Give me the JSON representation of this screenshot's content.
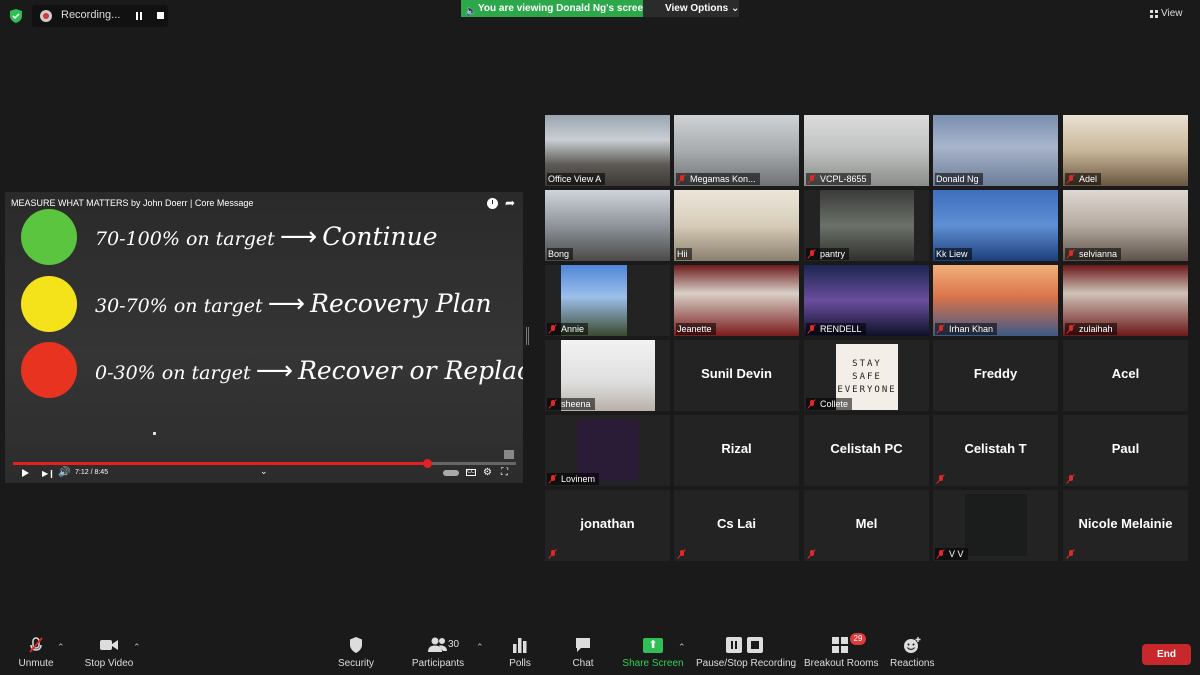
{
  "top": {
    "recording_label": "Recording...",
    "viewing_banner": "You are viewing Donald Ng's screen",
    "view_options": "View Options ⌄",
    "view_label": "View"
  },
  "share": {
    "video_title": "MEASURE WHAT MATTERS by John Doerr | Core Message",
    "lines": [
      {
        "pct": "70-100% on target",
        "action": "Continue"
      },
      {
        "pct": "30-70% on target",
        "action": "Recovery Plan"
      },
      {
        "pct": "0-30% on target",
        "action": "Recover or Replace"
      }
    ],
    "arrow": "⟶",
    "time": "7:12 / 8:45",
    "progress_fraction": 0.824
  },
  "tiles": [
    {
      "name": "Office View A",
      "type": "video",
      "muted": false,
      "bg": "linear-gradient(180deg,#9aa6b2 0%,#c9ced3 35%,#5d5a55 70%,#3d3a36 100%)"
    },
    {
      "name": "Megamas Kon...",
      "type": "video",
      "muted": true,
      "bg": "linear-gradient(180deg,#cfd3d6 0%,#a8acaf 50%,#707274 100%)"
    },
    {
      "name": "VCPL-8655",
      "type": "video",
      "muted": true,
      "bg": "linear-gradient(180deg,#dcdcdc 0%,#bfc2c0 50%,#8a8d8a 100%)"
    },
    {
      "name": "Donald Ng",
      "type": "video",
      "muted": false,
      "active": true,
      "bg": "linear-gradient(180deg,#7b8fb0 0%,#a8b5cc 45%,#6d7d98 100%)"
    },
    {
      "name": "Adel",
      "type": "video",
      "muted": true,
      "bg": "linear-gradient(180deg,#e9e1d2 0%,#c9b79a 50%,#6a5640 100%)"
    },
    {
      "name": "Bong",
      "type": "video",
      "muted": false,
      "bg": "linear-gradient(180deg,#cfd5db 0%,#8e949a 50%,#4c4a48 100%)"
    },
    {
      "name": "Hii",
      "type": "video",
      "muted": false,
      "bg": "linear-gradient(180deg,#ece6da 0%,#d6ccb8 50%,#8b7f6d 100%)"
    },
    {
      "name": "pantry",
      "type": "video",
      "muted": true,
      "bg": "linear-gradient(180deg,#3b3b3b 0%,#6b7268 50%,#2f302d 100%)"
    },
    {
      "name": "Kk Liew",
      "type": "video",
      "muted": false,
      "bg": "linear-gradient(180deg,#3f6fbd 0%,#5f8fd4 50%,#1e3f7a 100%)"
    },
    {
      "name": "selvianna",
      "type": "video",
      "muted": true,
      "bg": "linear-gradient(180deg,#ded8d2 0%,#b5aaa0 50%,#5d5249 100%)"
    },
    {
      "name": "Annie",
      "type": "video",
      "muted": true,
      "bg": "linear-gradient(180deg,#4f86d8 0%,#9cc0ea 45%,#3a4a2f 100%)"
    },
    {
      "name": "Jeanette",
      "type": "video",
      "muted": false,
      "bg": "linear-gradient(180deg,#6d1a1a 0%,#d8d0c8 40%,#7a1c1c 100%)"
    },
    {
      "name": "RENDELL",
      "type": "video",
      "muted": true,
      "bg": "linear-gradient(180deg,#1c2550 0%,#6a4e9e 50%,#0e1128 100%)"
    },
    {
      "name": "Irhan Khan",
      "type": "video",
      "muted": true,
      "bg": "linear-gradient(180deg,#f1b07a 0%,#d9734b 45%,#3e5a86 100%)"
    },
    {
      "name": "zulaihah",
      "type": "video",
      "muted": true,
      "bg": "linear-gradient(180deg,#6b1818 0%,#cfc3b8 40%,#6b1818 100%)"
    },
    {
      "name": "sheena",
      "type": "video",
      "muted": true,
      "bg": "linear-gradient(180deg,#f2f2f2 0%,#dedede 60%,#b8b0a8 100%)"
    },
    {
      "name": "Sunil Devin",
      "type": "name",
      "muted": false
    },
    {
      "name": "Collete",
      "type": "video",
      "muted": true,
      "sign": [
        "STAY",
        "SAFE",
        "EVERYONE"
      ],
      "bg": "#f3eee8"
    },
    {
      "name": "Freddy",
      "type": "name",
      "muted": false
    },
    {
      "name": "Acel",
      "type": "name",
      "muted": false
    },
    {
      "name": "Lovinem",
      "type": "video",
      "muted": true,
      "bg": "#2a1c36"
    },
    {
      "name": "Rizal",
      "type": "name",
      "muted": false
    },
    {
      "name": "Celistah PC",
      "type": "name",
      "muted": false
    },
    {
      "name": "Celistah T",
      "type": "name",
      "muted": true
    },
    {
      "name": "Paul",
      "type": "name",
      "muted": true
    },
    {
      "name": "jonathan",
      "type": "name",
      "muted": true
    },
    {
      "name": "Cs Lai",
      "type": "name",
      "muted": true
    },
    {
      "name": "Mel",
      "type": "name",
      "muted": true
    },
    {
      "name": "V V",
      "type": "video",
      "muted": true,
      "bg": "#1b1d1c"
    },
    {
      "name": "Nicole Melainie",
      "type": "name",
      "muted": true
    }
  ],
  "toolbar": {
    "unmute": "Unmute",
    "stop_video": "Stop Video",
    "security": "Security",
    "participants": "Participants",
    "participants_count": "30",
    "polls": "Polls",
    "chat": "Chat",
    "share_screen": "Share Screen",
    "recording": "Pause/Stop Recording",
    "breakout": "Breakout Rooms",
    "breakout_count": "29",
    "reactions": "Reactions",
    "end": "End"
  },
  "colors": {
    "accent_green": "#2fbf55",
    "active_speaker": "#e8f06b",
    "end_red": "#c8282b",
    "mute_red": "#e02828"
  }
}
